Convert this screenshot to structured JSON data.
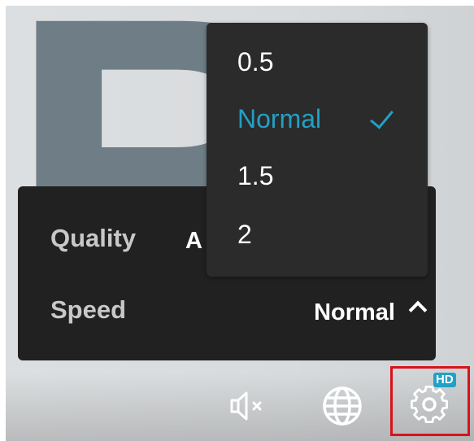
{
  "settings": {
    "quality": {
      "label": "Quality",
      "value": "A"
    },
    "speed": {
      "label": "Speed",
      "value": "Normal"
    }
  },
  "speed_menu": {
    "options": [
      "0.5",
      "Normal",
      "1.5",
      "2"
    ],
    "selected": "Normal"
  },
  "controls": {
    "mute_icon": "speaker-muted-icon",
    "language_icon": "globe-icon",
    "settings_icon": "gear-icon",
    "hd_badge": "HD"
  },
  "colors": {
    "accent": "#22a0c5",
    "panel_bg": "#212121",
    "menu_bg": "#2b2b2b",
    "highlight_border": "#d9121a"
  }
}
